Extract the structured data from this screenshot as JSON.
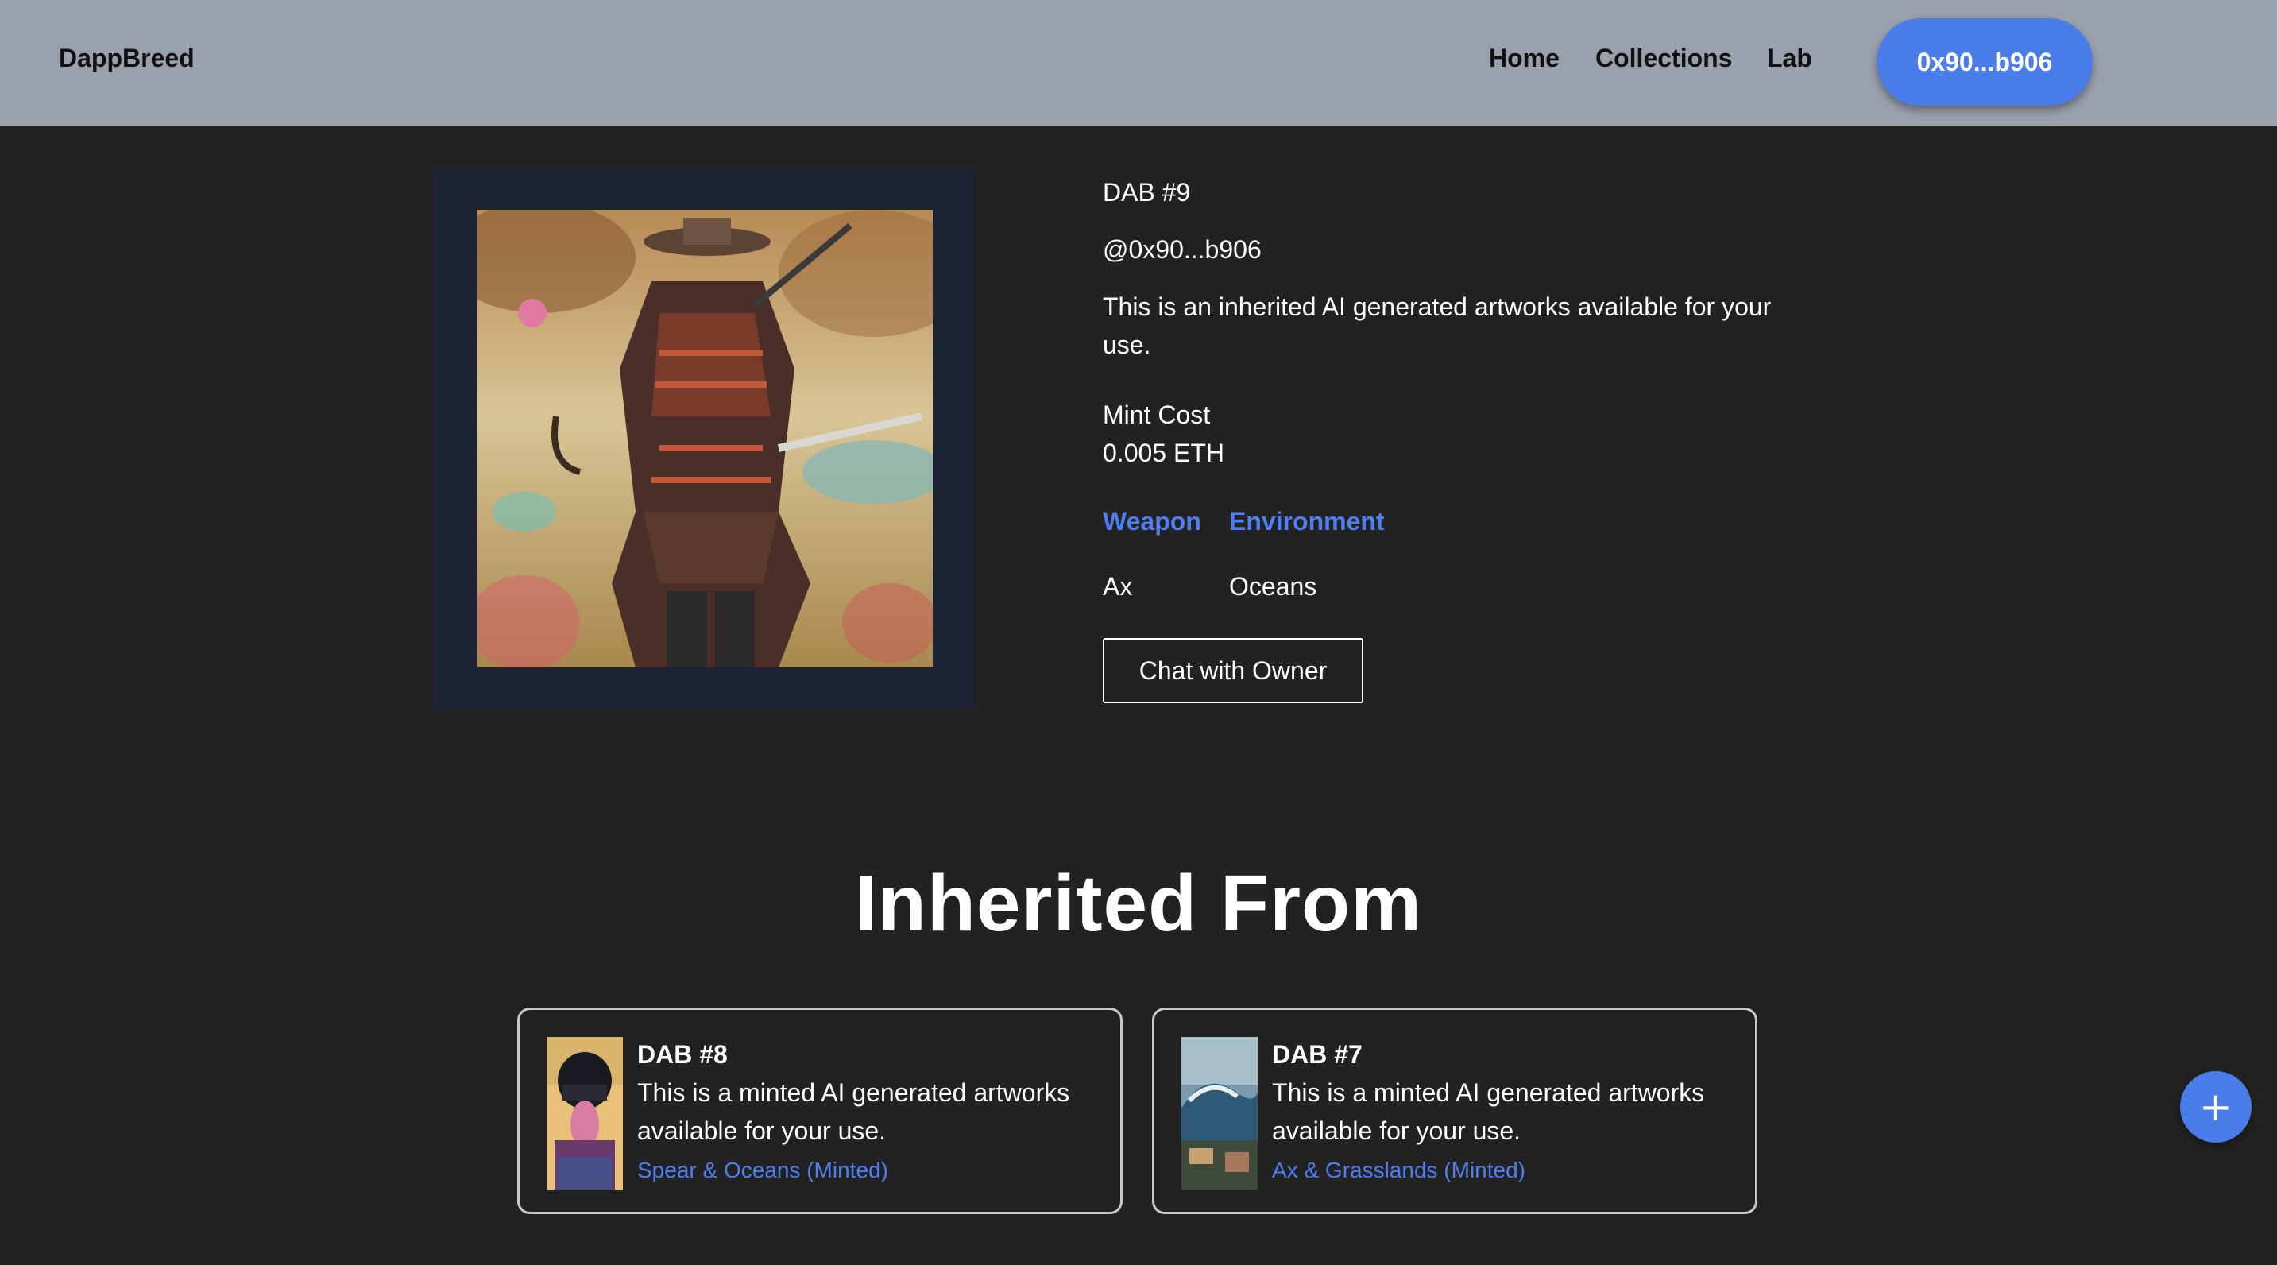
{
  "nav": {
    "brand": "DappBreed",
    "links": [
      "Home",
      "Collections",
      "Lab"
    ],
    "wallet": "0x90...b906"
  },
  "nft": {
    "title": "DAB #9",
    "owner": "@0x90...b906",
    "description_line1": "This is an inherited AI generated artworks available for your",
    "description_line2": "use.",
    "mint_cost_label": "Mint Cost",
    "mint_cost_value": "0.005 ETH",
    "traits": [
      {
        "label": "Weapon",
        "value": "Ax"
      },
      {
        "label": "Environment",
        "value": "Oceans"
      }
    ],
    "chat_button": "Chat with Owner"
  },
  "inherited": {
    "heading": "Inherited From",
    "cards": [
      {
        "title": "DAB #8",
        "desc_line1": "This is a minted AI generated artworks",
        "desc_line2": "available for your use.",
        "traits": "Spear & Oceans (Minted)"
      },
      {
        "title": "DAB #7",
        "desc_line1": "This is a minted AI generated artworks",
        "desc_line2": "available for your use.",
        "traits": "Ax & Grasslands (Minted)"
      }
    ]
  },
  "fab": {
    "icon": "plus-icon",
    "symbol": "+"
  },
  "colors": {
    "accent": "#4a7cea",
    "navbar": "#9aa0ac",
    "background": "#222222",
    "frame": "#1d2433"
  }
}
